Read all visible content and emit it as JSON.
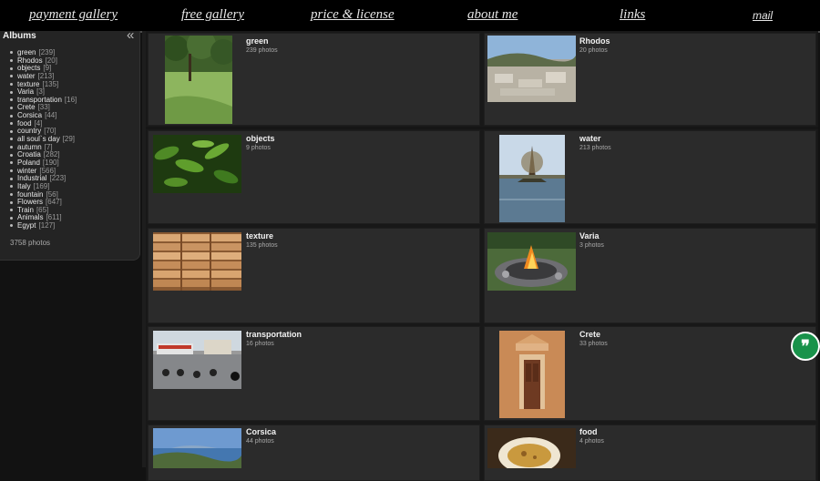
{
  "nav": {
    "items": [
      {
        "label": "payment gallery"
      },
      {
        "label": "free gallery"
      },
      {
        "label": "price & license"
      },
      {
        "label": "about me"
      },
      {
        "label": "links"
      },
      {
        "label": "mail"
      }
    ]
  },
  "sidebar": {
    "title": "Albums",
    "collapse_icon": "«",
    "albums": [
      {
        "name": "green",
        "count": "[239]"
      },
      {
        "name": "Rhodos",
        "count": "[20]"
      },
      {
        "name": "objects",
        "count": "[9]"
      },
      {
        "name": "water",
        "count": "[213]"
      },
      {
        "name": "texture",
        "count": "[135]"
      },
      {
        "name": "Varia",
        "count": "[3]"
      },
      {
        "name": "transportation",
        "count": "[16]"
      },
      {
        "name": "Crete",
        "count": "[33]"
      },
      {
        "name": "Corsica",
        "count": "[44]"
      },
      {
        "name": "food",
        "count": "[4]"
      },
      {
        "name": "country",
        "count": "[70]"
      },
      {
        "name": "all soul`s day",
        "count": "[29]"
      },
      {
        "name": "autumn",
        "count": "[7]"
      },
      {
        "name": "Croatia",
        "count": "[282]"
      },
      {
        "name": "Poland",
        "count": "[190]"
      },
      {
        "name": "winter",
        "count": "[566]"
      },
      {
        "name": "Industrial",
        "count": "[223]"
      },
      {
        "name": "Italy",
        "count": "[169]"
      },
      {
        "name": "fountain",
        "count": "[56]"
      },
      {
        "name": "Flowers",
        "count": "[647]"
      },
      {
        "name": "Train",
        "count": "[65]"
      },
      {
        "name": "Animals",
        "count": "[611]"
      },
      {
        "name": "Egypt",
        "count": "[127]"
      }
    ],
    "total": "3758 photos"
  },
  "gallery": [
    {
      "name": "green",
      "count": "239 photos",
      "icon": "meadow-photo-icon"
    },
    {
      "name": "Rhodos",
      "count": "20 photos",
      "icon": "ruins-photo-icon"
    },
    {
      "name": "objects",
      "count": "9 photos",
      "icon": "leaves-photo-icon"
    },
    {
      "name": "water",
      "count": "213 photos",
      "icon": "lake-photo-icon"
    },
    {
      "name": "texture",
      "count": "135 photos",
      "icon": "planks-photo-icon"
    },
    {
      "name": "Varia",
      "count": "3 photos",
      "icon": "campfire-photo-icon"
    },
    {
      "name": "transportation",
      "count": "16 photos",
      "icon": "motorcycles-photo-icon"
    },
    {
      "name": "Crete",
      "count": "33 photos",
      "icon": "door-photo-icon"
    },
    {
      "name": "Corsica",
      "count": "44 photos",
      "icon": "coast-photo-icon"
    },
    {
      "name": "food",
      "count": "4 photos",
      "icon": "soup-photo-icon"
    }
  ],
  "quote_button": {
    "glyph": "❞",
    "icon": "quote-icon",
    "color": "#18924a"
  },
  "colors": {
    "background": "#121212",
    "card": "#2b2b2b",
    "nav": "#000000"
  }
}
